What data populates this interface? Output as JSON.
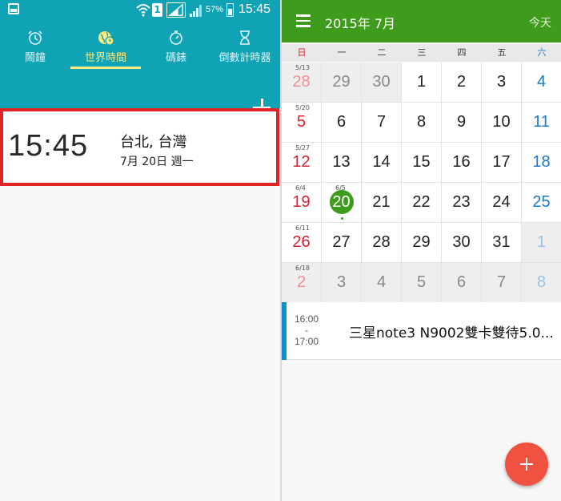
{
  "status_bar": {
    "battery_percent": "57%",
    "time": "15:45",
    "sim_slot": "1",
    "icons": [
      "gallery-icon",
      "wifi-icon",
      "sim-icon",
      "signal-icon",
      "signal-icon",
      "battery-charging-icon"
    ]
  },
  "clock_app": {
    "tabs": [
      {
        "label": "鬧鐘",
        "icon": "alarm-icon",
        "active": false
      },
      {
        "label": "世界時間",
        "icon": "world-clock-icon",
        "active": true
      },
      {
        "label": "碼錶",
        "icon": "stopwatch-icon",
        "active": false
      },
      {
        "label": "倒數計時器",
        "icon": "timer-icon",
        "active": false
      }
    ],
    "add_icon": "plus-icon",
    "world_clock": {
      "time": "15:45",
      "city": "台北, 台灣",
      "date": "7月 20日 週一"
    },
    "colors": {
      "toolbar": "#0fa3b5",
      "active_tab": "#ffe97a",
      "highlight_border": "#e02426"
    }
  },
  "calendar_app": {
    "title": "2015年 7月",
    "today_label": "今天",
    "menu_icon": "hamburger-icon",
    "weekdays": [
      "日",
      "一",
      "二",
      "三",
      "四",
      "五",
      "六"
    ],
    "weeks": [
      {
        "week_label": "5/13",
        "days": [
          {
            "d": "28",
            "o": true
          },
          {
            "d": "29",
            "o": true
          },
          {
            "d": "30",
            "o": true
          },
          {
            "d": "1",
            "o": false
          },
          {
            "d": "2",
            "o": false
          },
          {
            "d": "3",
            "o": false
          },
          {
            "d": "4",
            "o": false
          }
        ]
      },
      {
        "week_label": "5/20",
        "days": [
          {
            "d": "5",
            "o": false
          },
          {
            "d": "6",
            "o": false
          },
          {
            "d": "7",
            "o": false
          },
          {
            "d": "8",
            "o": false
          },
          {
            "d": "9",
            "o": false
          },
          {
            "d": "10",
            "o": false
          },
          {
            "d": "11",
            "o": false
          }
        ]
      },
      {
        "week_label": "5/27",
        "days": [
          {
            "d": "12",
            "o": false
          },
          {
            "d": "13",
            "o": false
          },
          {
            "d": "14",
            "o": false
          },
          {
            "d": "15",
            "o": false
          },
          {
            "d": "16",
            "o": false
          },
          {
            "d": "17",
            "o": false
          },
          {
            "d": "18",
            "o": false
          }
        ]
      },
      {
        "week_label": "6/4",
        "today_label": "6/5",
        "days": [
          {
            "d": "19",
            "o": false
          },
          {
            "d": "20",
            "o": false,
            "today": true
          },
          {
            "d": "21",
            "o": false
          },
          {
            "d": "22",
            "o": false
          },
          {
            "d": "23",
            "o": false
          },
          {
            "d": "24",
            "o": false
          },
          {
            "d": "25",
            "o": false
          }
        ]
      },
      {
        "week_label": "6/11",
        "days": [
          {
            "d": "26",
            "o": false
          },
          {
            "d": "27",
            "o": false
          },
          {
            "d": "28",
            "o": false
          },
          {
            "d": "29",
            "o": false
          },
          {
            "d": "30",
            "o": false
          },
          {
            "d": "31",
            "o": false
          },
          {
            "d": "1",
            "o": true
          }
        ]
      },
      {
        "week_label": "6/18",
        "days": [
          {
            "d": "2",
            "o": true
          },
          {
            "d": "3",
            "o": true
          },
          {
            "d": "4",
            "o": true
          },
          {
            "d": "5",
            "o": true
          },
          {
            "d": "6",
            "o": true
          },
          {
            "d": "7",
            "o": true
          },
          {
            "d": "8",
            "o": true
          }
        ]
      }
    ],
    "event": {
      "start": "16:00",
      "separator": "-",
      "end": "17:00",
      "title": "三星note3 N9002雙卡雙待5.0..."
    },
    "fab_icon": "plus-icon",
    "colors": {
      "header": "#3e9b1b",
      "sunday": "#d91e2e",
      "saturday": "#1a78c9",
      "event_bar": "#0f8fcf",
      "fab": "#f05241"
    }
  }
}
